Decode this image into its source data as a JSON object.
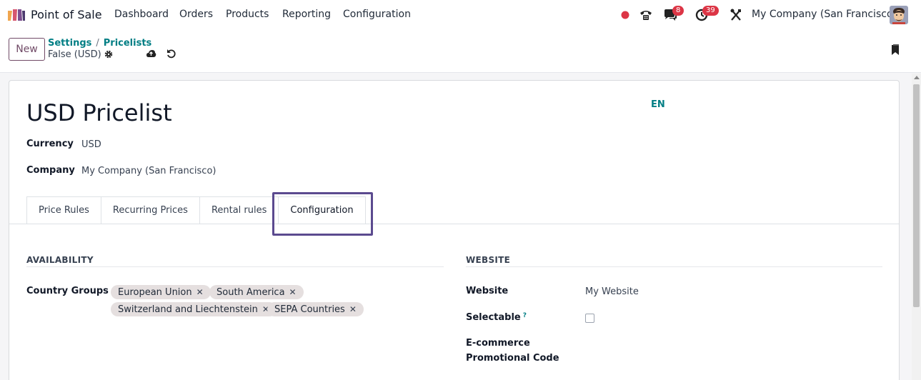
{
  "navbar": {
    "app_name": "Point of Sale",
    "menu": [
      "Dashboard",
      "Orders",
      "Products",
      "Reporting",
      "Configuration"
    ],
    "chat_count": "8",
    "activity_count": "39",
    "company": "My Company (San Francisco)"
  },
  "control": {
    "new_label": "New",
    "breadcrumb": [
      "Settings",
      "Pricelists"
    ],
    "record_name": "False (USD)"
  },
  "form": {
    "title": "USD Pricelist",
    "lang": "EN",
    "currency_label": "Currency",
    "currency_value": "USD",
    "company_label": "Company",
    "company_value": "My Company (San Francisco)"
  },
  "tabs": [
    "Price Rules",
    "Recurring Prices",
    "Rental rules",
    "Configuration"
  ],
  "availability": {
    "title": "AVAILABILITY",
    "country_groups_label": "Country Groups",
    "tags": [
      "European Union",
      "South America",
      "Switzerland and Liechtenstein",
      "SEPA Countries"
    ]
  },
  "website": {
    "title": "WEBSITE",
    "website_label": "Website",
    "website_value": "My Website",
    "selectable_label": "Selectable",
    "selectable_tip": "?",
    "ecommerce_label_1": "E-commerce",
    "ecommerce_label_2": "Promotional Code"
  },
  "colors": {
    "primary": "#714b67",
    "link": "#017e84",
    "badge": "#dc3545",
    "highlight": "#5b4a8f"
  }
}
